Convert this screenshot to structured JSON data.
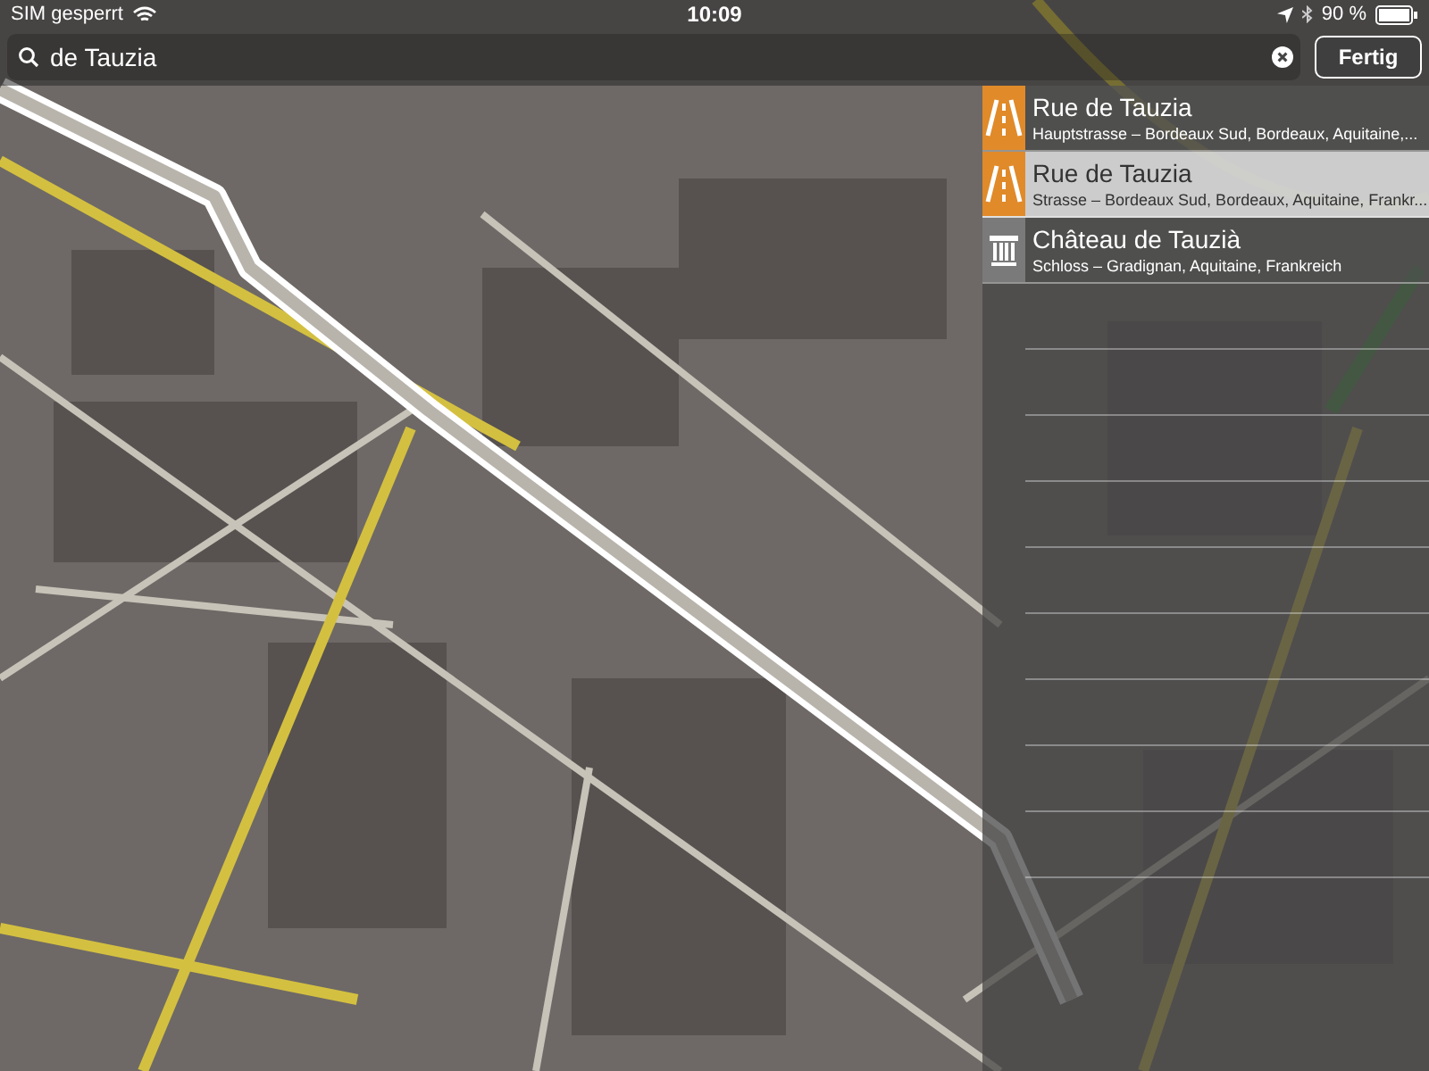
{
  "status_bar": {
    "carrier": "SIM gesperrt",
    "time": "10:09",
    "battery": "90 %"
  },
  "search": {
    "value": "de Tauzia",
    "done_button": "Fertig"
  },
  "results": [
    {
      "kind": "road",
      "color": "#e08a2a",
      "title": "Rue de Tauzia",
      "subtitle": "Hauptstrasse – Bordeaux Sud, Bordeaux, Aquitaine,...",
      "selected": false
    },
    {
      "kind": "road",
      "color": "#e08a2a",
      "title": "Rue de Tauzia",
      "subtitle": "Strasse – Bordeaux Sud, Bordeaux, Aquitaine, Frankr...",
      "selected": true
    },
    {
      "kind": "monument",
      "color": "#7a7a7a",
      "title": "Château de Tauzià",
      "subtitle": "Schloss – Gradignan, Aquitaine, Frankreich",
      "selected": false
    }
  ]
}
